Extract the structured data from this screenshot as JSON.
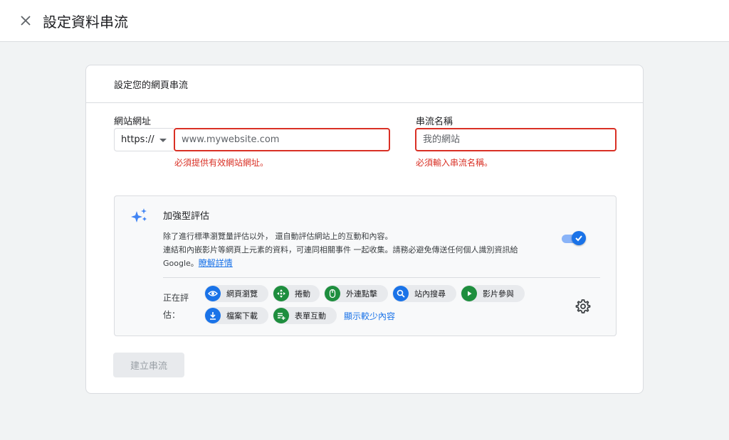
{
  "header": {
    "title": "設定資料串流"
  },
  "card": {
    "title": "設定您的網頁串流",
    "url_field": {
      "label": "網站網址",
      "protocol": "https://",
      "placeholder": "www.mywebsite.com",
      "error": "必須提供有效網站網址。"
    },
    "name_field": {
      "label": "串流名稱",
      "placeholder": "我的網站",
      "error": "必須輸入串流名稱。"
    },
    "enhanced": {
      "title": "加強型評估",
      "desc_line1": "除了進行標準瀏覽量評估以外， 還自動評估網站上的互動和內容。",
      "desc_line2": "連結和內嵌影片等網頁上元素的資料，可連同相關事件 一起收集。請務必避免傳送任何個人識別資訊給",
      "desc_line3": "Google。",
      "learn_more": "瞭解詳情",
      "toggle_on": true,
      "measuring_label": "正在評估：",
      "chips": [
        {
          "label": "網頁瀏覽",
          "icon": "eye-icon",
          "color": "#1a73e8"
        },
        {
          "label": "捲動",
          "icon": "scroll-icon",
          "color": "#1e8e3e"
        },
        {
          "label": "外連點擊",
          "icon": "mouse-icon",
          "color": "#1e8e3e"
        },
        {
          "label": "站內搜尋",
          "icon": "search-icon",
          "color": "#1a73e8"
        },
        {
          "label": "影片參與",
          "icon": "play-icon",
          "color": "#1e8e3e"
        },
        {
          "label": "檔案下載",
          "icon": "download-icon",
          "color": "#1a73e8"
        },
        {
          "label": "表單互動",
          "icon": "form-icon",
          "color": "#1e8e3e"
        }
      ],
      "show_less": "顯示較少內容"
    },
    "create_button": "建立串流"
  }
}
